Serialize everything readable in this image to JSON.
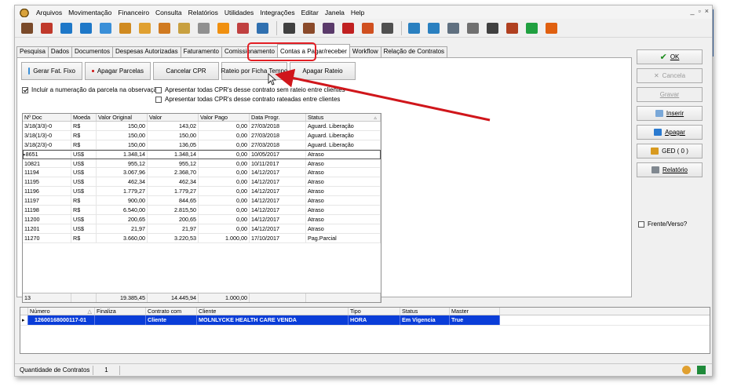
{
  "menu": {
    "items": [
      "Arquivos",
      "Movimentação",
      "Financeiro",
      "Consulta",
      "Relatórios",
      "Utilidades",
      "Integrações",
      "Editar",
      "Janela",
      "Help"
    ],
    "window_controls": [
      "_",
      "▫",
      "×"
    ]
  },
  "toolbar": {
    "icons": [
      {
        "name": "users-icon",
        "color": "#7a4a2a"
      },
      {
        "name": "user-icon",
        "color": "#c0392b"
      },
      {
        "name": "thumb-up-icon",
        "color": "#1e78c8"
      },
      {
        "name": "thumb-up-blue-icon",
        "color": "#1e78c8"
      },
      {
        "name": "thumb-up-alt-icon",
        "color": "#3a8fd8"
      },
      {
        "name": "thumb-settings-icon",
        "color": "#d08a20"
      },
      {
        "name": "folder-icon",
        "color": "#e0a030"
      },
      {
        "name": "pencil-icon",
        "color": "#d07a20"
      },
      {
        "name": "document-icon",
        "color": "#c8a040"
      },
      {
        "name": "document-edit-icon",
        "color": "#909090"
      },
      {
        "name": "globe-icon",
        "color": "#f09010"
      },
      {
        "name": "calendar-icon",
        "color": "#c04040"
      },
      {
        "name": "screen-icon",
        "color": "#3070b0"
      },
      {
        "name": "return-icon",
        "color": "#404040"
      },
      {
        "name": "user-tie-icon",
        "color": "#8a4a2a"
      },
      {
        "name": "group-icon",
        "color": "#5a3a6a"
      },
      {
        "name": "arrow-double-icon",
        "color": "#c02020"
      },
      {
        "name": "arrow-pair-icon",
        "color": "#d05020"
      },
      {
        "name": "camera-icon",
        "color": "#505050"
      },
      {
        "name": "thumb-chart-icon",
        "color": "#2a80c0"
      },
      {
        "name": "thumb-chart-alt-icon",
        "color": "#2a80c0"
      },
      {
        "name": "report-icon",
        "color": "#607080"
      },
      {
        "name": "grid-icon",
        "color": "#707070"
      },
      {
        "name": "scissors-icon",
        "color": "#404040"
      },
      {
        "name": "tools-icon",
        "color": "#b04020"
      },
      {
        "name": "puzzle-icon",
        "color": "#20a040"
      },
      {
        "name": "exit-icon",
        "color": "#e06010"
      }
    ]
  },
  "tabs": [
    "Pesquisa",
    "Dados",
    "Documentos",
    "Despesas Autorizadas",
    "Faturamento",
    "Comissionamento",
    "Contas a Pagar/receber",
    "Workflow",
    "Relação de Contratos"
  ],
  "active_tab": "Contas a Pagar/receber",
  "actions": {
    "gerar": "Gerar Fat. Fixo",
    "apagar_parcelas": "Apagar Parcelas",
    "cancelar_cpr": "Cancelar CPR",
    "rateio": "Rateio por Ficha Tempo",
    "apagar_rateio": "Apagar Rateio"
  },
  "checkboxes": {
    "incluir": "Incluir a numeração da parcela na observação",
    "apresentar_sem": "Apresentar todas CPR's desse contrato sem rateio entre clientes",
    "apresentar_rateadas": "Apresentar todas CPR's desse contrato rateadas entre clientes"
  },
  "grid": {
    "columns": [
      "Nº Doc",
      "Moeda",
      "Valor Original",
      "Valor",
      "Valor Pago",
      "Data Progr.",
      "Status"
    ],
    "rows": [
      [
        "3/18(3/3)-0",
        "R$",
        "150,00",
        "143,02",
        "0,00",
        "27/03/2018",
        "Aguard. Liberação"
      ],
      [
        "3/18(1/3)-0",
        "R$",
        "150,00",
        "150,00",
        "0,00",
        "27/03/2018",
        "Aguard. Liberação"
      ],
      [
        "3/18(2/3)-0",
        "R$",
        "150,00",
        "136,05",
        "0,00",
        "27/03/2018",
        "Aguard. Liberação"
      ],
      [
        "8651",
        "US$",
        "1.348,14",
        "1.348,14",
        "0,00",
        "10/05/2017",
        "Atraso"
      ],
      [
        "10821",
        "US$",
        "955,12",
        "955,12",
        "0,00",
        "10/11/2017",
        "Atraso"
      ],
      [
        "11194",
        "US$",
        "3.067,96",
        "2.368,70",
        "0,00",
        "14/12/2017",
        "Atraso"
      ],
      [
        "11195",
        "US$",
        "462,34",
        "462,34",
        "0,00",
        "14/12/2017",
        "Atraso"
      ],
      [
        "11196",
        "US$",
        "1.779,27",
        "1.779,27",
        "0,00",
        "14/12/2017",
        "Atraso"
      ],
      [
        "11197",
        "R$",
        "900,00",
        "844,65",
        "0,00",
        "14/12/2017",
        "Atraso"
      ],
      [
        "11198",
        "R$",
        "6.540,00",
        "2.815,50",
        "0,00",
        "14/12/2017",
        "Atraso"
      ],
      [
        "11200",
        "US$",
        "200,65",
        "200,65",
        "0,00",
        "14/12/2017",
        "Atraso"
      ],
      [
        "11201",
        "US$",
        "21,97",
        "21,97",
        "0,00",
        "14/12/2017",
        "Atraso"
      ],
      [
        "11270",
        "R$",
        "3.660,00",
        "3.220,53",
        "1.000,00",
        "17/10/2017",
        "Pag.Parcial"
      ]
    ],
    "current_row": 3,
    "footer": {
      "count": "13",
      "valor_original": "19.385,45",
      "valor": "14.445,94",
      "valor_pago": "1.000,00"
    }
  },
  "contracts": {
    "columns": [
      "Número",
      "Finaliza",
      "Contrato com",
      "Cliente",
      "Tipo",
      "Status",
      "Master"
    ],
    "row": [
      "12600168000117-01",
      "",
      "Cliente",
      "MOLNLYCKE HEALTH CARE VENDA",
      "HORA",
      "Em Vigencia",
      "True"
    ]
  },
  "side": {
    "ok": "OK",
    "cancelar": "Cancela",
    "gravar": "Gravar",
    "inserir": "Inserir",
    "apagar": "Apagar",
    "ged": "GED ( 0 )",
    "relatorio": "Relatório",
    "frente_verso": "Frente/Verso?"
  },
  "status": {
    "label": "Quantidade de Contratos",
    "value": "1"
  },
  "colors": {
    "highlight_red": "#e31e24",
    "selection_blue": "#0a3dd8",
    "ok_green": "#1a8a1a"
  }
}
